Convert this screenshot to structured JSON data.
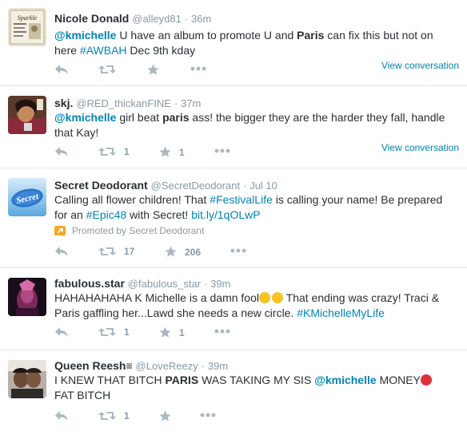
{
  "tweets": [
    {
      "name": "Nicole Donald",
      "handle": "@alleyd81",
      "sep": "·",
      "time": "36m",
      "text_mention": "@kmichelle",
      "text_a": " U have an album to promote U and ",
      "text_bold": "Paris",
      "text_b": " can fix this but not on here ",
      "text_hashtag": "#AWBAH",
      "text_c": " Dec 9th kday",
      "view_conversation": "View conversation",
      "retweets": "",
      "favorites": "",
      "avatar_text": "Sparkle"
    },
    {
      "name": "skj.",
      "handle": "@RED_thickanFINE",
      "sep": "·",
      "time": "37m",
      "text_mention": "@kmichelle",
      "text_a": " girl beat ",
      "text_bold": "paris",
      "text_b": " ass! the bigger they are the harder they fall, handle that Kay!",
      "view_conversation": "View conversation",
      "retweets": "1",
      "favorites": "1"
    },
    {
      "name": "Secret Deodorant",
      "handle": "@SecretDeodorant",
      "sep": "·",
      "time": "Jul 10",
      "text_a": "Calling all flower children! That ",
      "text_hashtag": "#FestivalLife",
      "text_b": " is calling your name! Be prepared for an ",
      "text_hashtag2": "#Epic48",
      "text_c": " with Secret!  ",
      "text_link": "bit.ly/1qOLwP",
      "promoted": "Promoted by Secret Deodorant",
      "retweets": "17",
      "favorites": "206",
      "avatar_text": "Secret"
    },
    {
      "name": "fabulous.star",
      "handle": "@fabulous_star",
      "sep": "·",
      "time": "39m",
      "text_a": "HAHAHAHAHA K Michelle is a damn fool",
      "text_b": " That ending was crazy! Traci & Paris gaffling her...Lawd she needs a new circle. ",
      "text_hashtag": "#KMichelleMyLife",
      "retweets": "1",
      "favorites": "1"
    },
    {
      "name": "Queen Reesh",
      "name_suffix": "≡",
      "handle": "@LoveReezy",
      "sep": "·",
      "time": "39m",
      "text_a": "I KNEW THAT BITCH ",
      "text_bold": "PARIS",
      "text_b": " WAS TAKING MY SIS ",
      "text_mention": "@kmichelle",
      "text_c": " MONEY",
      "text_d": " FAT BITCH",
      "retweets": "1",
      "favorites": ""
    }
  ],
  "colors": {
    "link": "#0084b4",
    "muted": "#8899a6",
    "icon": "#aab8c2",
    "border": "#e1e8ed",
    "promoted": "#f5a623"
  },
  "icons": [
    "reply-icon",
    "retweet-icon",
    "favorite-icon",
    "more-icon",
    "promoted-icon"
  ]
}
